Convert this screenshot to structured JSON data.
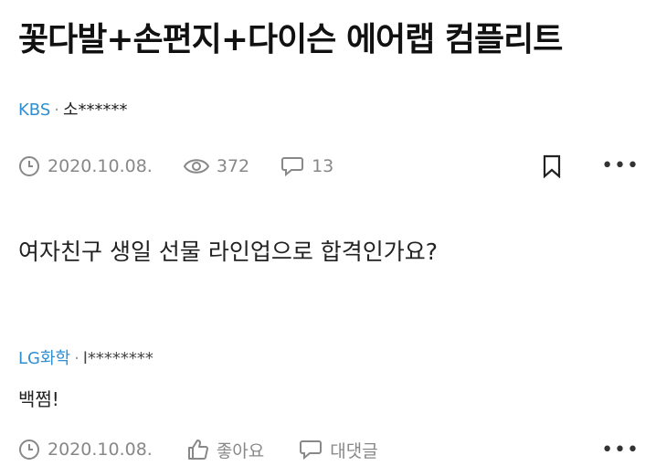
{
  "post": {
    "title": "꽃다발+손편지+다이슨 에어랩 컴플리트",
    "author": {
      "company": "KBS",
      "separator": "·",
      "name": "소******"
    },
    "meta": {
      "date": "2020.10.08.",
      "views": "372",
      "comments": "13"
    },
    "body": "여자친구 생일 선물 라인업으로 합격인가요?"
  },
  "comment": {
    "author": {
      "company": "LG화학",
      "separator": "·",
      "name": "l********"
    },
    "text": "백쩜!",
    "meta": {
      "date": "2020.10.08.",
      "like_label": "좋아요",
      "reply_label": "대댓글"
    }
  },
  "icons": [
    "clock-icon",
    "eye-icon",
    "speech-bubble-icon",
    "bookmark-icon",
    "more-icon",
    "thumbs-up-icon"
  ],
  "colors": {
    "company_link": "#2f8fd0",
    "meta_gray": "#888888"
  }
}
